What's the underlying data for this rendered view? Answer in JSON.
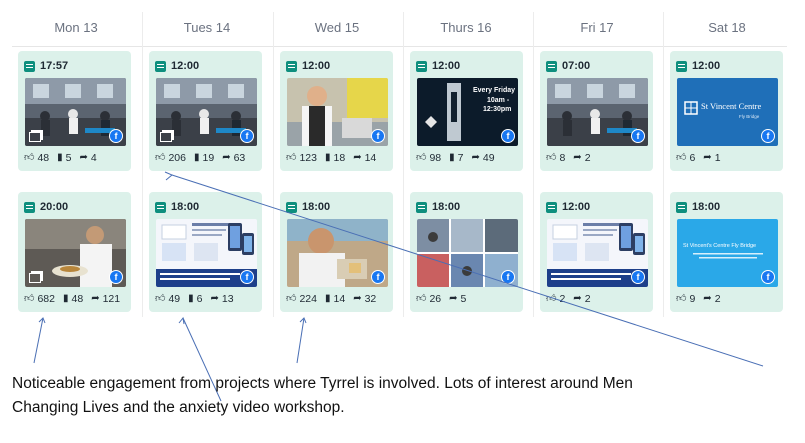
{
  "days": [
    "Mon 13",
    "Tues 14",
    "Wed 15",
    "Thurs 16",
    "Fri 17",
    "Sat 18"
  ],
  "posts": [
    {
      "time": "17:57",
      "likes": "48",
      "comments": "5",
      "shares": "4",
      "thumb": "room",
      "multi": true
    },
    {
      "time": "12:00",
      "likes": "206",
      "comments": "19",
      "shares": "63",
      "thumb": "room",
      "multi": true
    },
    {
      "time": "12:00",
      "likes": "123",
      "comments": "18",
      "shares": "14",
      "thumb": "kitchen",
      "multi": false
    },
    {
      "time": "12:00",
      "likes": "98",
      "comments": "7",
      "shares": "49",
      "thumb": "poster-dark",
      "multi": false,
      "poster_text": [
        "Every Friday",
        "10am -",
        "12:30pm"
      ]
    },
    {
      "time": "07:00",
      "likes": "8",
      "comments": "",
      "shares": "2",
      "thumb": "room",
      "multi": false
    },
    {
      "time": "12:00",
      "likes": "6",
      "comments": "",
      "shares": "1",
      "thumb": "blue-logo",
      "multi": false,
      "poster_text": [
        "St Vincent Centre",
        "Fly Bridge"
      ]
    },
    {
      "time": "20:00",
      "likes": "682",
      "comments": "48",
      "shares": "121",
      "thumb": "chef",
      "multi": true
    },
    {
      "time": "18:00",
      "likes": "49",
      "comments": "6",
      "shares": "13",
      "thumb": "flyer",
      "multi": false
    },
    {
      "time": "18:00",
      "likes": "224",
      "comments": "14",
      "shares": "32",
      "thumb": "man-food",
      "multi": false
    },
    {
      "time": "18:00",
      "likes": "26",
      "comments": "",
      "shares": "5",
      "thumb": "collage",
      "multi": false
    },
    {
      "time": "12:00",
      "likes": "2",
      "comments": "",
      "shares": "2",
      "thumb": "flyer",
      "multi": false
    },
    {
      "time": "18:00",
      "likes": "9",
      "comments": "",
      "shares": "2",
      "thumb": "light-blue",
      "multi": false,
      "poster_text": [
        "St Vincent's Centre Fly Bridge"
      ]
    }
  ],
  "icons": {
    "time": "calendar-icon",
    "likes": "thumbs-up-icon",
    "comments": "comment-icon",
    "shares": "share-arrow-icon",
    "network": "facebook-icon"
  },
  "colors": {
    "card_bg": "#dcf1ea",
    "accent": "#0e8f7e",
    "facebook": "#1877f2",
    "annotation_line": "#4a6fb5"
  },
  "caption": {
    "line1": "Noticeable engagement from projects where Tyrrel is involved. Lots of interest around Men",
    "line2": "Changing Lives and the anxiety video workshop."
  }
}
